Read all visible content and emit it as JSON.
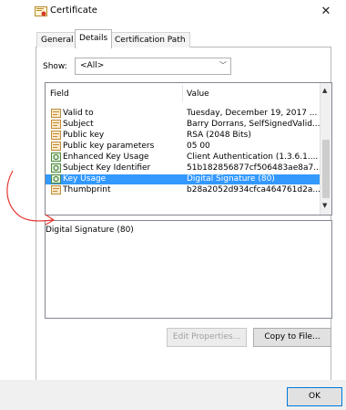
{
  "window": {
    "title": "Certificate"
  },
  "tabs": [
    {
      "label": "General"
    },
    {
      "label": "Details"
    },
    {
      "label": "Certification Path"
    }
  ],
  "show": {
    "label": "Show:",
    "value": "<All>"
  },
  "list": {
    "columns": [
      "Field",
      "Value"
    ],
    "rows": [
      {
        "field": "Valid to",
        "value": "Tuesday, December 19, 2017 ...",
        "icon": "cert-field-icon"
      },
      {
        "field": "Subject",
        "value": "Barry Dorrans, SelfSignedValid...",
        "icon": "cert-field-icon"
      },
      {
        "field": "Public key",
        "value": "RSA (2048 Bits)",
        "icon": "cert-field-icon"
      },
      {
        "field": "Public key parameters",
        "value": "05 00",
        "icon": "cert-field-icon"
      },
      {
        "field": "Enhanced Key Usage",
        "value": "Client Authentication (1.3.6.1....",
        "icon": "cert-extension-icon"
      },
      {
        "field": "Subject Key Identifier",
        "value": "51b182856877cf506483ae8a7...",
        "icon": "cert-extension-icon"
      },
      {
        "field": "Key Usage",
        "value": "Digital Signature (80)",
        "icon": "cert-extension-icon",
        "selected": true
      },
      {
        "field": "Thumbprint",
        "value": "b28a2052d934cfca464761d2a...",
        "icon": "cert-field-icon"
      }
    ]
  },
  "detail": {
    "text": "Digital Signature (80)"
  },
  "buttons": {
    "edit_properties": "Edit Properties...",
    "copy_to_file": "Copy to File...",
    "ok": "OK"
  },
  "colors": {
    "selection": "#3399ff",
    "annotation": "#e53935"
  }
}
